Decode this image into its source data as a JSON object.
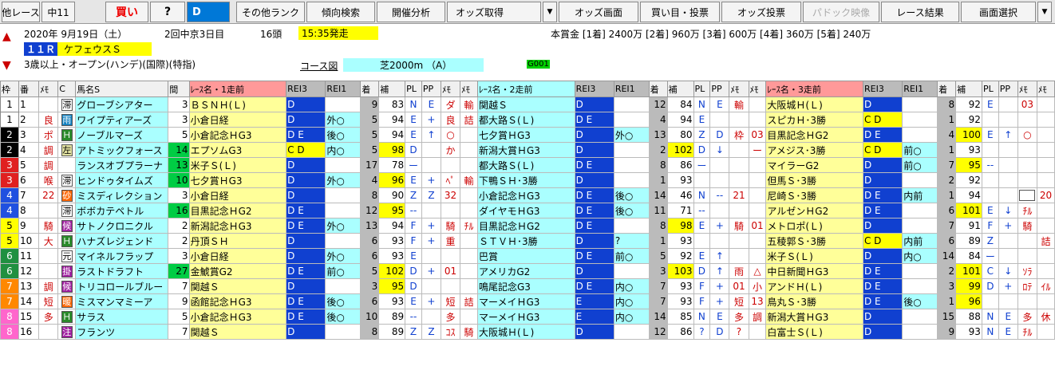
{
  "toolbar": {
    "buttons": [
      "他レース",
      "中11",
      "買い",
      "?",
      "D",
      "その他ランク",
      "傾向検索",
      "開催分析",
      "オッズ取得",
      "オッズ画面",
      "買い目・投票",
      "オッズ投票",
      "パドック映像",
      "レース結果",
      "画面選択"
    ]
  },
  "race": {
    "date": "2020年 9月19日（土）",
    "meeting": "2回中京3日目",
    "field": "16頭",
    "start": "15:35発走",
    "race_no": "１１Ｒ",
    "race_name": "ケフェウスＳ",
    "conditions": "3歳以上・オープン(ハンデ)(国際)(特指)",
    "course_label": "コース図",
    "course": "芝2000m （A）",
    "grade_code": "G001",
    "prize": "本賞金 [1着] 2400万 [2着] 960万 [3着] 600万 [4着] 360万 [5着] 240万"
  },
  "headers": [
    "枠",
    "番",
    "ﾒﾓ",
    "C",
    "馬名S",
    "間",
    "ﾚｰｽ名・1走前",
    "REI3",
    "REI1",
    "着",
    "補",
    "PL",
    "PP",
    "ﾒﾓ",
    "ﾒﾓ",
    "ﾚｰｽ名・2走前",
    "REI3",
    "REI1",
    "着",
    "補",
    "PL",
    "PP",
    "ﾒﾓ",
    "ﾒﾓ",
    "ﾚｰｽ名・3走前",
    "REI3",
    "REI1",
    "着",
    "補",
    "PL",
    "PP",
    "ﾒﾓ",
    "ﾒﾓ"
  ],
  "rows": [
    {
      "w": "1",
      "n": "1",
      "m": "",
      "cm": "滞",
      "ct": "gl",
      "name": "グローブシアター",
      "iv": "3",
      "r": [
        [
          "ＢＳＮＨ(Ｌ)",
          "D",
          "",
          "9",
          "83",
          "N",
          "E",
          "ダ",
          "輸"
        ],
        [
          "関越Ｓ",
          "D",
          "",
          "12",
          "84",
          "N",
          "E",
          "輸",
          ""
        ],
        [
          "大阪城Ｈ(Ｌ)",
          "D",
          "",
          "8",
          "92",
          "E",
          "",
          "03",
          ""
        ]
      ]
    },
    {
      "w": "1",
      "n": "2",
      "m": "良",
      "cm": "雨",
      "ct": "ch",
      "name": "ワイプティアーズ",
      "iv": "3",
      "r": [
        [
          "小倉日経",
          "D",
          "外○",
          "5",
          "94",
          "E",
          "+",
          "良",
          "詰"
        ],
        [
          "都大路Ｓ(Ｌ)",
          "D E",
          "",
          "4",
          "94",
          "E",
          "",
          "",
          ""
        ],
        [
          "スピカＨ･3勝",
          "C D",
          "",
          "1",
          "92",
          "",
          "",
          "",
          ""
        ]
      ]
    },
    {
      "w": "2",
      "n": "3",
      "m": "ポ",
      "cm": "Ｈ",
      "ct": "hf",
      "name": "ノーブルマーズ",
      "iv": "5",
      "r": [
        [
          "小倉記念ＨG3",
          "D E",
          "後○",
          "5",
          "94",
          "E",
          "↑",
          "○",
          ""
        ],
        [
          "七夕賞ＨG3",
          "D",
          "外○",
          "13",
          "80",
          "Z",
          "D",
          "枠",
          "03"
        ],
        [
          "目黒記念ＨG2",
          "D E",
          "",
          "4",
          "100",
          "E",
          "↑",
          "○",
          ""
        ]
      ]
    },
    {
      "w": "2",
      "n": "4",
      "m": "調",
      "cm": "左",
      "ct": "kt",
      "name": "アトミックフォース",
      "iv": "14",
      "r": [
        [
          "エプソムG3",
          "C D",
          "内○",
          "5",
          "98",
          "D",
          "",
          "か",
          ""
        ],
        [
          "新潟大賞ＨG3",
          "D",
          "",
          "2",
          "102",
          "D",
          "↓",
          "",
          "ー"
        ],
        [
          "アメジス･3勝",
          "C D",
          "前○",
          "1",
          "93",
          "",
          "",
          "",
          ""
        ]
      ]
    },
    {
      "w": "3",
      "n": "5",
      "m": "調",
      "cm": "",
      "ct": "",
      "name": "ランスオブプラーナ",
      "iv": "13",
      "r": [
        [
          "米子Ｓ(Ｌ)",
          "D",
          "",
          "17",
          "78",
          "ー",
          "",
          "",
          ""
        ],
        [
          "都大路Ｓ(Ｌ)",
          "D E",
          "",
          "8",
          "86",
          "ー",
          "",
          "",
          ""
        ],
        [
          "マイラーG2",
          "D",
          "前○",
          "7",
          "95",
          "--",
          "",
          "",
          ""
        ]
      ]
    },
    {
      "w": "3",
      "n": "6",
      "m": "喉",
      "cm": "滞",
      "ct": "gl",
      "name": "ヒンドゥタイムズ",
      "iv": "10",
      "r": [
        [
          "七夕賞ＨG3",
          "D",
          "外○",
          "4",
          "96",
          "E",
          "+",
          "ﾍﾟ",
          "輸"
        ],
        [
          "下鴨ＳＨ･3勝",
          "D",
          "",
          "1",
          "93",
          "",
          "",
          "",
          ""
        ],
        [
          "但馬Ｓ･3勝",
          "D",
          "",
          "2",
          "92",
          "",
          "",
          "",
          ""
        ]
      ]
    },
    {
      "w": "4",
      "n": "7",
      "m": "22",
      "cm": "砂",
      "ct": "sm",
      "name": "ミスディレクション",
      "iv": "3",
      "r": [
        [
          "小倉日経",
          "D",
          "",
          "8",
          "90",
          "Z",
          "Z",
          "32",
          ""
        ],
        [
          "小倉記念ＨG3",
          "D E",
          "後○",
          "14",
          "46",
          "N",
          "--",
          "21",
          ""
        ],
        [
          "尼崎Ｓ･3勝",
          "D E",
          "内前",
          "1",
          "94",
          "",
          "",
          "box",
          "20"
        ]
      ]
    },
    {
      "w": "4",
      "n": "8",
      "m": "",
      "cm": "滞",
      "ct": "gl",
      "name": "ボボカテペトル",
      "iv": "16",
      "r": [
        [
          "目黒記念ＨG2",
          "D E",
          "",
          "12",
          "95",
          "--",
          "",
          "",
          ""
        ],
        [
          "ダイヤモＨG3",
          "D E",
          "後○",
          "11",
          "71",
          "--",
          "",
          "",
          ""
        ],
        [
          "アルゼンＨG2",
          "D E",
          "",
          "6",
          "101",
          "E",
          "↓",
          "ﾁﾙ",
          ""
        ]
      ]
    },
    {
      "w": "5",
      "n": "9",
      "m": "騎",
      "cm": "候",
      "ct": "sc",
      "name": "サトノクロニクル",
      "iv": "2",
      "r": [
        [
          "新潟記念ＨG3",
          "D E",
          "外○",
          "13",
          "94",
          "F",
          "+",
          "騎",
          "ﾁﾙ"
        ],
        [
          "目黒記念ＨG2",
          "D E",
          "",
          "8",
          "98",
          "E",
          "+",
          "騎",
          "01"
        ],
        [
          "メトロポ(Ｌ)",
          "D",
          "",
          "7",
          "91",
          "F",
          "+",
          "騎",
          ""
        ]
      ]
    },
    {
      "w": "5",
      "n": "10",
      "m": "大",
      "cm": "Ｈ",
      "ct": "hf",
      "name": "ハナズレジェンド",
      "iv": "2",
      "r": [
        [
          "丹頂ＳＨ",
          "D",
          "",
          "6",
          "93",
          "F",
          "+",
          "重",
          ""
        ],
        [
          "ＳＴＶＨ･3勝",
          "D",
          "?",
          "1",
          "93",
          "",
          "",
          "",
          ""
        ],
        [
          "五稜郭Ｓ･3勝",
          "C D",
          "内前",
          "6",
          "89",
          "Z",
          "",
          "",
          "詰"
        ]
      ]
    },
    {
      "w": "6",
      "n": "11",
      "m": "",
      "cm": "元",
      "ct": "gl",
      "name": "マイネルフラップ",
      "iv": "3",
      "r": [
        [
          "小倉日経",
          "D",
          "外○",
          "6",
          "93",
          "E",
          "",
          "",
          ""
        ],
        [
          "巴賞",
          "D E",
          "前○",
          "5",
          "92",
          "E",
          "↑",
          "",
          ""
        ],
        [
          "米子Ｓ(Ｌ)",
          "D",
          "内○",
          "14",
          "84",
          "ー",
          "",
          "",
          ""
        ]
      ]
    },
    {
      "w": "6",
      "n": "12",
      "m": "",
      "cm": "掛",
      "ct": "sc",
      "name": "ラストドラフト",
      "iv": "27",
      "r": [
        [
          "金鯱賞G2",
          "D E",
          "前○",
          "5",
          "102",
          "D",
          "+",
          "01",
          ""
        ],
        [
          "アメリカG2",
          "D",
          "",
          "3",
          "103",
          "D",
          "↑",
          "雨",
          "△"
        ],
        [
          "中日新聞ＨG3",
          "D E",
          "",
          "2",
          "101",
          "C",
          "↓",
          "ｿﾗ",
          ""
        ]
      ]
    },
    {
      "w": "7",
      "n": "13",
      "m": "調",
      "cm": "候",
      "ct": "sc",
      "name": "トリコロールブルー",
      "iv": "7",
      "r": [
        [
          "関越Ｓ",
          "D",
          "",
          "3",
          "95",
          "D",
          "",
          "",
          ""
        ],
        [
          "鳴尾記念G3",
          "D E",
          "内○",
          "7",
          "93",
          "F",
          "+",
          "01",
          "小"
        ],
        [
          "アンドＨ(Ｌ)",
          "D E",
          "",
          "3",
          "99",
          "D",
          "+",
          "ﾛﾃ",
          "ｲﾙ"
        ]
      ]
    },
    {
      "w": "7",
      "n": "14",
      "m": "短",
      "cm": "暖",
      "ct": "sm",
      "name": "ミスマンマミーア",
      "iv": "9",
      "r": [
        [
          "函館記念ＨG3",
          "D E",
          "後○",
          "6",
          "93",
          "E",
          "+",
          "短",
          "詰"
        ],
        [
          "マーメイＨG3",
          "E",
          "内○",
          "7",
          "93",
          "F",
          "+",
          "短",
          "13"
        ],
        [
          "鳥丸Ｓ･3勝",
          "D E",
          "後○",
          "1",
          "96",
          "",
          "",
          "",
          ""
        ]
      ]
    },
    {
      "w": "8",
      "n": "15",
      "m": "多",
      "cm": "Ｈ",
      "ct": "hf",
      "name": "サラス",
      "iv": "5",
      "r": [
        [
          "小倉記念ＨG3",
          "D E",
          "後○",
          "10",
          "89",
          "--",
          "",
          "多",
          ""
        ],
        [
          "マーメイＨG3",
          "E",
          "内○",
          "14",
          "85",
          "N",
          "E",
          "多",
          "調"
        ],
        [
          "新潟大賞ＨG3",
          "D",
          "",
          "15",
          "88",
          "N",
          "E",
          "多",
          "休"
        ]
      ]
    },
    {
      "w": "8",
      "n": "16",
      "m": "",
      "cm": "注",
      "ct": "sc",
      "name": "フランツ",
      "iv": "7",
      "r": [
        [
          "関越Ｓ",
          "D",
          "",
          "8",
          "89",
          "Z",
          "Z",
          "ｺｽ",
          "騎"
        ],
        [
          "大阪城Ｈ(Ｌ)",
          "D",
          "",
          "12",
          "86",
          "?",
          "D",
          "?",
          ""
        ],
        [
          "白富士Ｓ(Ｌ)",
          "D",
          "",
          "9",
          "93",
          "N",
          "E",
          "ﾁﾙ",
          ""
        ]
      ]
    }
  ]
}
